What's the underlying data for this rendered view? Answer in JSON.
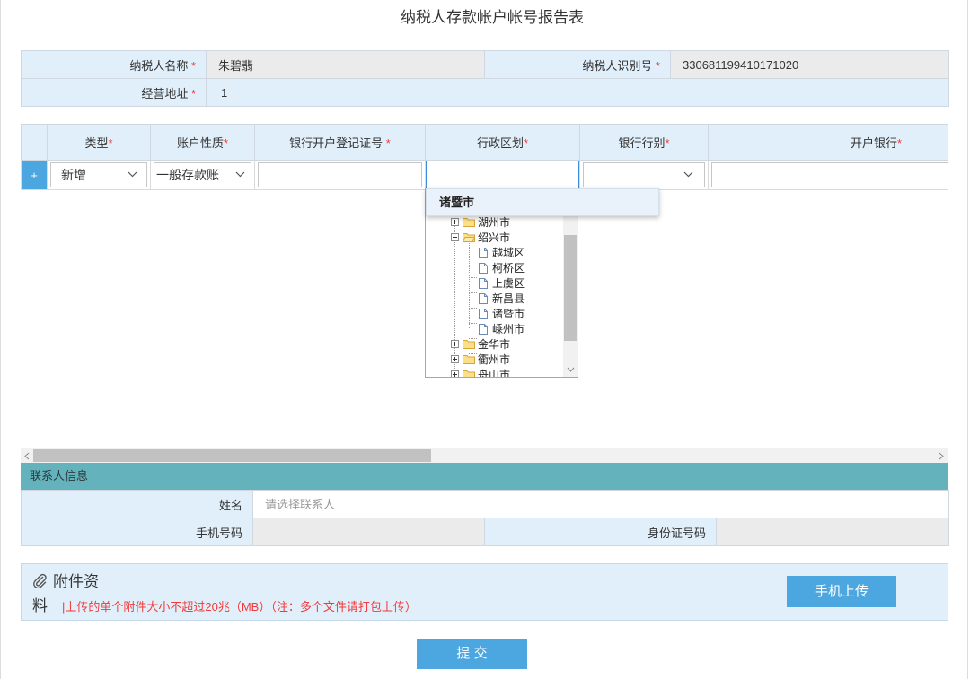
{
  "page": {
    "title": "纳税人存款帐户帐号报告表"
  },
  "colors": {
    "label-bg": "#e1effa",
    "readonly-bg": "#ebebeb",
    "border": "#cfd8e0",
    "accent": "#4ca6df",
    "teal": "#64b2bc",
    "required": "#f23a3a",
    "focus": "#3b8ee0"
  },
  "taxpayer": {
    "name": {
      "label": "纳税人名称",
      "mark": " *",
      "value": "朱碧翡"
    },
    "tax_id": {
      "label": "纳税人识别号",
      "mark": " *",
      "value": "330681199410171020"
    },
    "address": {
      "label": "经营地址",
      "mark": " *",
      "value": "1"
    }
  },
  "accounts": {
    "headers": [
      {
        "label": "类型",
        "mark": "*"
      },
      {
        "label": "账户性质",
        "mark": "*"
      },
      {
        "label": "银行开户登记证号",
        "mark": " *"
      },
      {
        "label": "行政区划",
        "mark": "*"
      },
      {
        "label": "银行行别",
        "mark": "*"
      },
      {
        "label": "开户银行",
        "mark": "*"
      }
    ],
    "row": {
      "add_label": "+",
      "type": "新增",
      "nature": "一般存款账",
      "license_no": "",
      "region": "",
      "bank_category": "",
      "bank": ""
    }
  },
  "region_dropdown": {
    "suggestion": "诸暨市",
    "tree": [
      {
        "label": "湖州市",
        "icon": "folder-icon",
        "state": "collapsed"
      },
      {
        "label": "绍兴市",
        "icon": "folder-open-icon",
        "state": "expanded",
        "children": [
          {
            "label": "越城区",
            "icon": "file-icon"
          },
          {
            "label": "柯桥区",
            "icon": "file-icon"
          },
          {
            "label": "上虞区",
            "icon": "file-icon"
          },
          {
            "label": "新昌县",
            "icon": "file-icon"
          },
          {
            "label": "诸暨市",
            "icon": "file-icon"
          },
          {
            "label": "嵊州市",
            "icon": "file-icon"
          }
        ]
      },
      {
        "label": "金华市",
        "icon": "folder-icon",
        "state": "collapsed"
      },
      {
        "label": "衢州市",
        "icon": "folder-icon",
        "state": "collapsed"
      },
      {
        "label": "舟山市",
        "icon": "folder-icon",
        "state": "collapsed"
      }
    ]
  },
  "contact": {
    "section_title": "联系人信息",
    "name_label": "姓名",
    "name_placeholder": "请选择联系人",
    "name_value": "",
    "phone_label": "手机号码",
    "phone_value": "",
    "id_card_label": "身份证号码",
    "id_card_value": ""
  },
  "attachment": {
    "icon": "paperclip-icon",
    "title": "附件资料",
    "notice": "|上传的单个附件大小不超过20兆（MB）（注：多个文件请打包上传）",
    "upload_button": "手机上传"
  },
  "submit": {
    "label": "提 交"
  }
}
